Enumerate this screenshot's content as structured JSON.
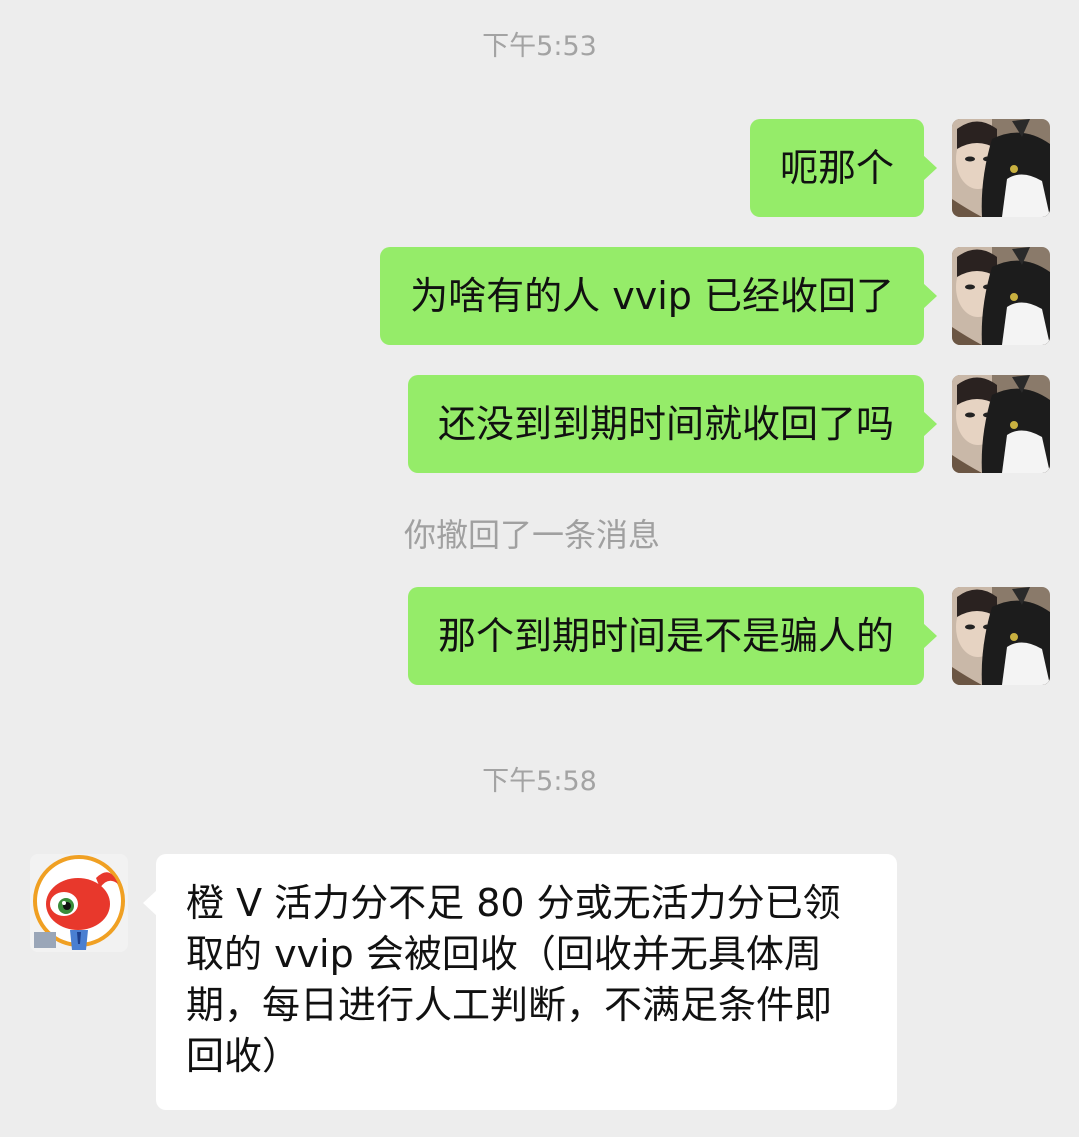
{
  "chat": {
    "timestamps": [
      "下午5:53",
      "下午5:58"
    ],
    "messages": [
      {
        "sender": "me",
        "text": "呃那个"
      },
      {
        "sender": "me",
        "text": "为啥有的人 vvip 已经收回了"
      },
      {
        "sender": "me",
        "text": "还没到到期时间就收回了吗"
      },
      {
        "sender": "me",
        "text": "那个到期时间是不是骗人的"
      },
      {
        "sender": "other",
        "text": "橙 V 活力分不足 80 分或无活力分已领取的 vvip 会被回收（回收并无具体周期，每日进行人工判断，不满足条件即回收）"
      }
    ],
    "recall_notice": "你撤回了一条消息"
  },
  "avatars": {
    "me": "user-avatar-cat-photo",
    "other": "weibo-mascot-avatar"
  },
  "colors": {
    "background": "#ededed",
    "my_bubble": "#95ec69",
    "other_bubble": "#ffffff",
    "timestamp_text": "#a3a3a3"
  }
}
